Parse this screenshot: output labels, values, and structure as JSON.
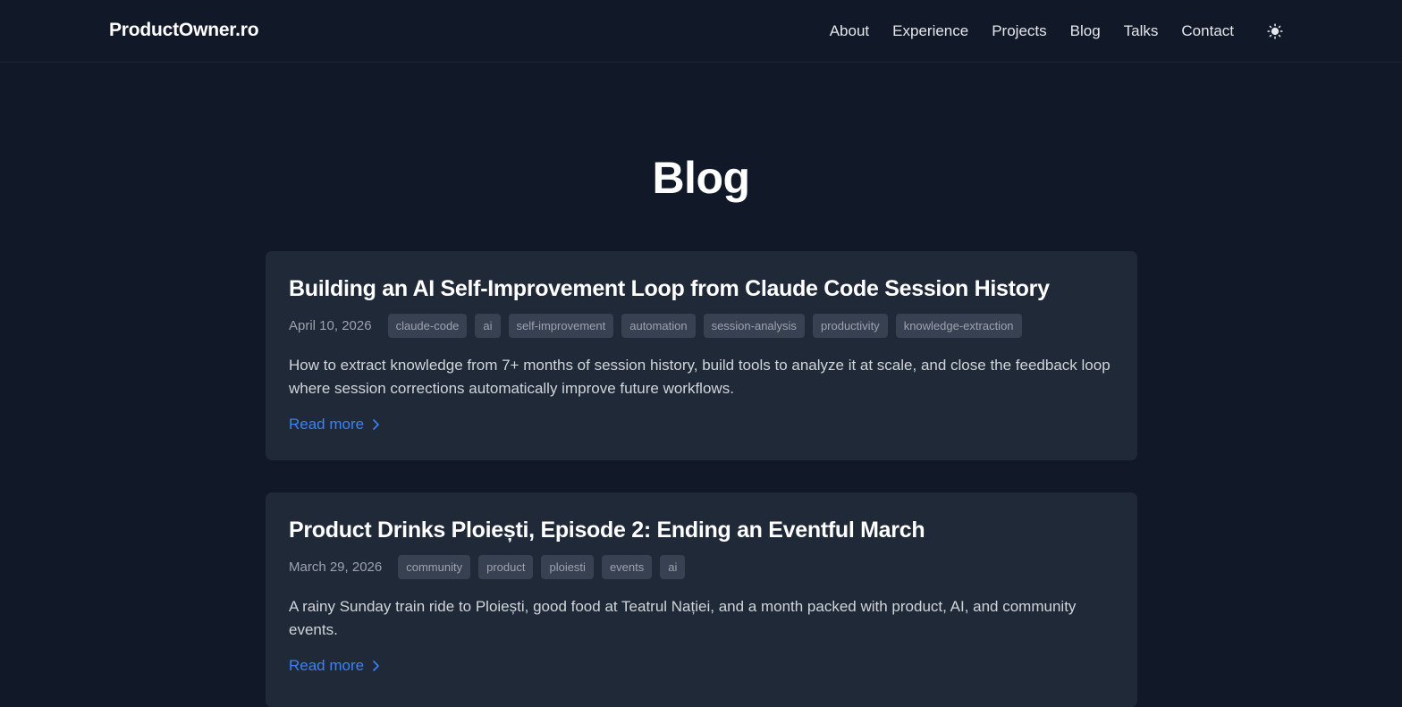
{
  "header": {
    "brand": "ProductOwner.ro",
    "nav": [
      {
        "label": "About"
      },
      {
        "label": "Experience"
      },
      {
        "label": "Projects"
      },
      {
        "label": "Blog"
      },
      {
        "label": "Talks"
      },
      {
        "label": "Contact"
      }
    ],
    "theme_toggle_icon": "sun-icon"
  },
  "page": {
    "title": "Blog"
  },
  "posts": [
    {
      "title": "Building an AI Self-Improvement Loop from Claude Code Session History",
      "date": "April 10, 2026",
      "tags": [
        "claude-code",
        "ai",
        "self-improvement",
        "automation",
        "session-analysis",
        "productivity",
        "knowledge-extraction"
      ],
      "excerpt": "How to extract knowledge from 7+ months of session history, build tools to analyze it at scale, and close the feedback loop where session corrections automatically improve future workflows.",
      "read_more": "Read more"
    },
    {
      "title": "Product Drinks Ploiești, Episode 2: Ending an Eventful March",
      "date": "March 29, 2026",
      "tags": [
        "community",
        "product",
        "ploiesti",
        "events",
        "ai"
      ],
      "excerpt": "A rainy Sunday train ride to Ploiești, good food at Teatrul Nației, and a month packed with product, AI, and community events.",
      "read_more": "Read more"
    }
  ],
  "colors": {
    "background": "#111827",
    "card": "#1f2937",
    "tag_bg": "#374151",
    "link": "#3b82f6"
  }
}
